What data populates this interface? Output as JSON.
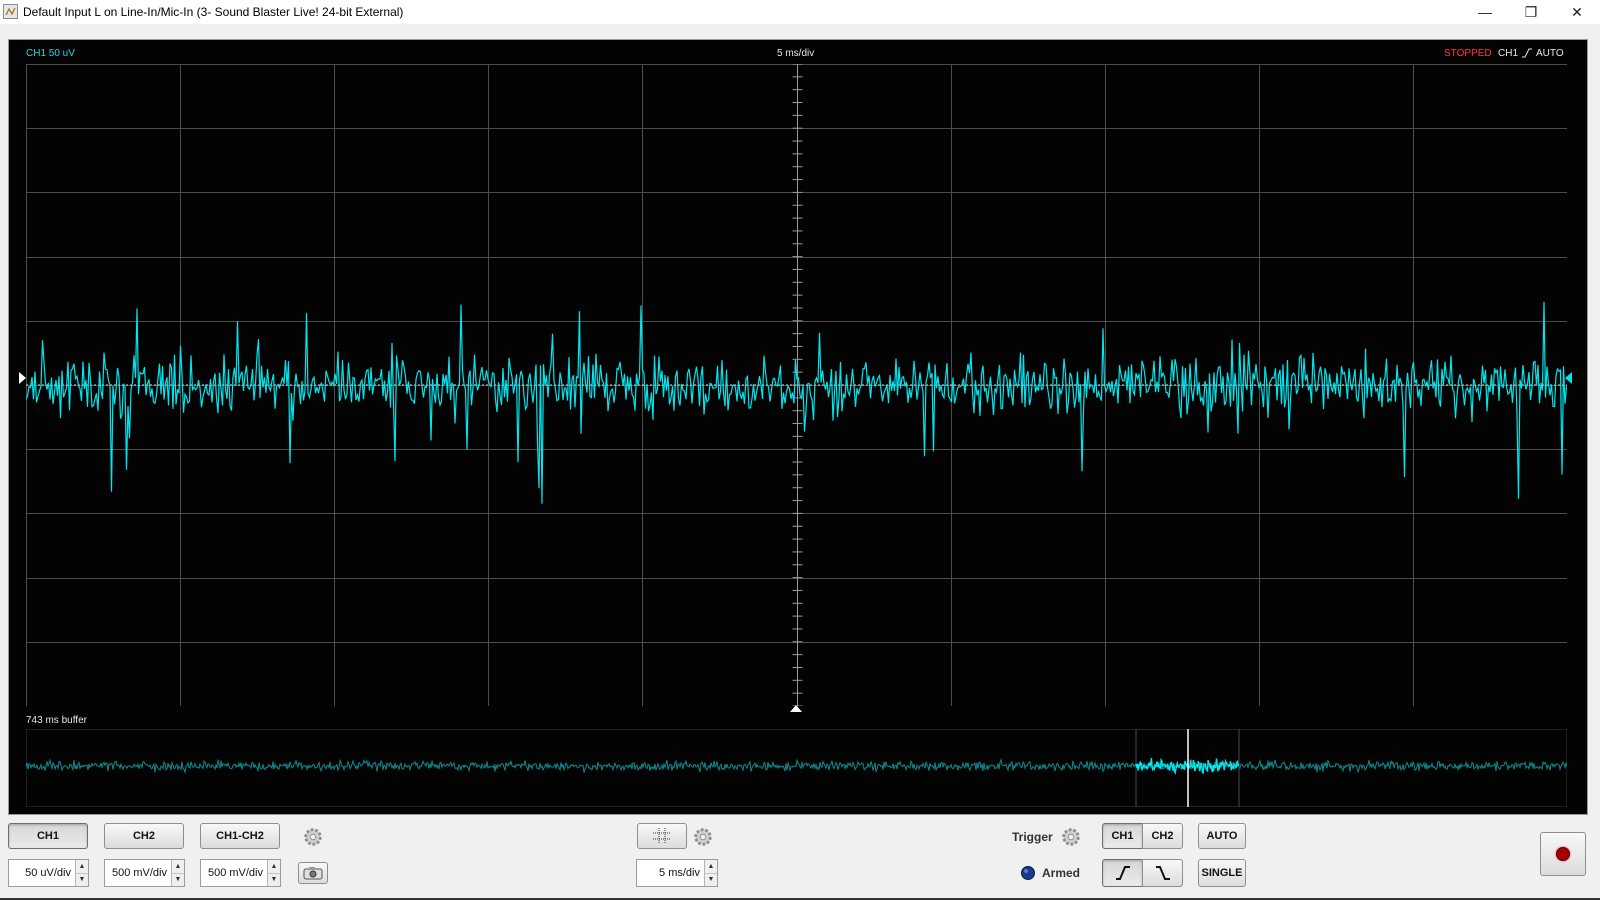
{
  "window": {
    "title": "Default Input L on Line-In/Mic-In (3- Sound Blaster Live! 24-bit External)",
    "controls": {
      "minimize": "—",
      "restore": "❐",
      "close": "✕"
    }
  },
  "scope": {
    "ch1_scale_label": "CH1 50 uV",
    "timebase_label": "5 ms/div",
    "status": "STOPPED",
    "trigger_channel": "CH1",
    "trigger_mode": "AUTO",
    "trace_color": "#00e5ee",
    "status_color": "#ff3a3a",
    "buffer_label": "743 ms buffer"
  },
  "channels": {
    "ch1_button": "CH1",
    "ch2_button": "CH2",
    "diff_button": "CH1-CH2",
    "ch1_scale": "50 uV/div",
    "ch2_scale": "500 mV/div",
    "diff_scale": "500 mV/div"
  },
  "timebase": {
    "value": "5 ms/div"
  },
  "trigger": {
    "label": "Trigger",
    "ch1": "CH1",
    "ch2": "CH2",
    "auto": "AUTO",
    "single": "SINGLE",
    "armed_label": "Armed"
  },
  "icons": {
    "gear": "gear-icon",
    "camera": "camera-icon",
    "grid": "grid-icon",
    "rising_edge": "rising-edge-icon",
    "falling_edge": "falling-edge-icon",
    "record": "record-icon"
  }
}
